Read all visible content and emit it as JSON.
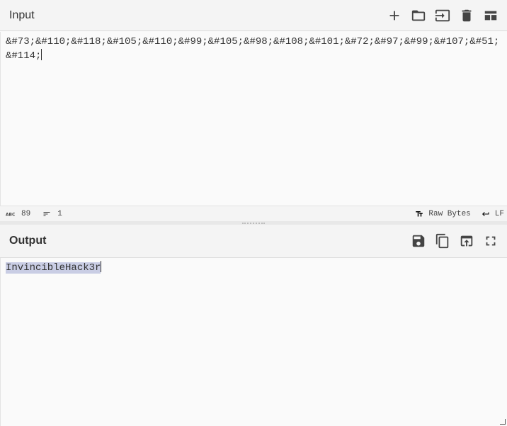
{
  "input": {
    "title": "Input",
    "text": "&#73;&#110;&#118;&#105;&#110;&#99;&#105;&#98;&#108;&#101;&#72;&#97;&#99;&#107;&#51;&#114;"
  },
  "status": {
    "length": "89",
    "lines": "1",
    "encoding": "Raw Bytes",
    "eol": "LF"
  },
  "output": {
    "title": "Output",
    "text": "InvincibleHack3r"
  },
  "icons": {
    "input": [
      "plus-icon",
      "folder-open-icon",
      "input-file-icon",
      "trash-icon",
      "layout-icon"
    ],
    "output": [
      "save-icon",
      "copy-icon",
      "replace-input-icon",
      "fullscreen-icon"
    ]
  }
}
